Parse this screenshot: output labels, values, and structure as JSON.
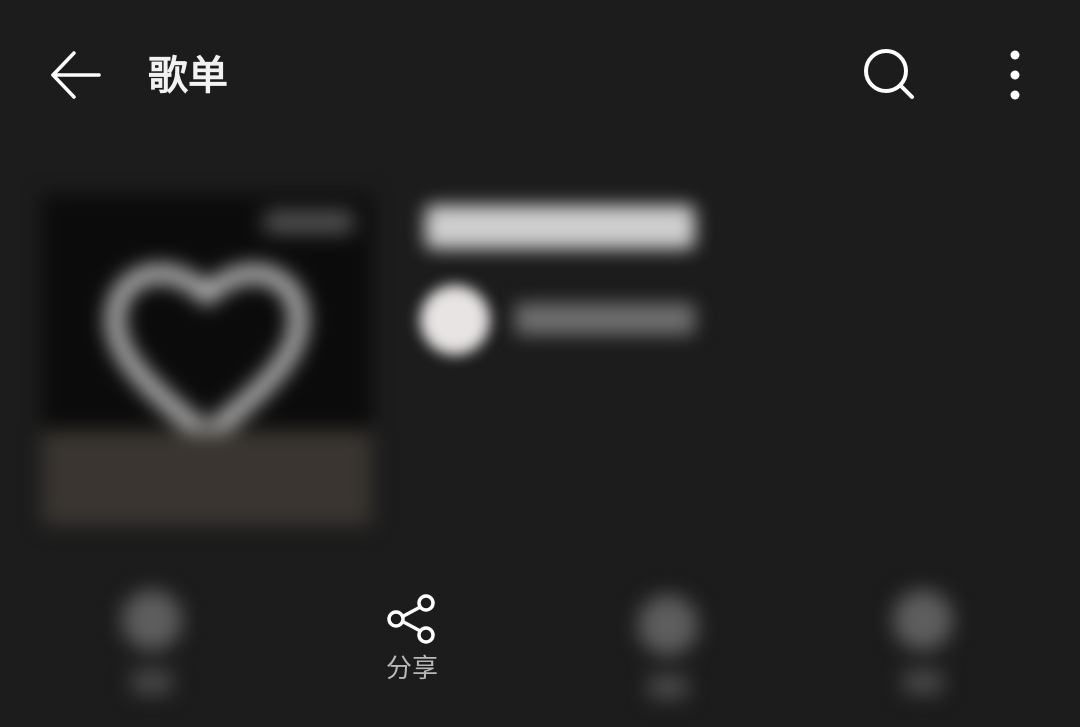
{
  "header": {
    "title": "歌单",
    "back_icon": "back-arrow-icon",
    "search_icon": "search-icon",
    "more_icon": "more-vertical-icon"
  },
  "actions": {
    "share": {
      "label": "分享",
      "icon": "share-icon"
    }
  },
  "colors": {
    "background": "#1c1c1c",
    "text_primary": "#f2f2f2",
    "text_secondary": "#b8b8b8"
  }
}
